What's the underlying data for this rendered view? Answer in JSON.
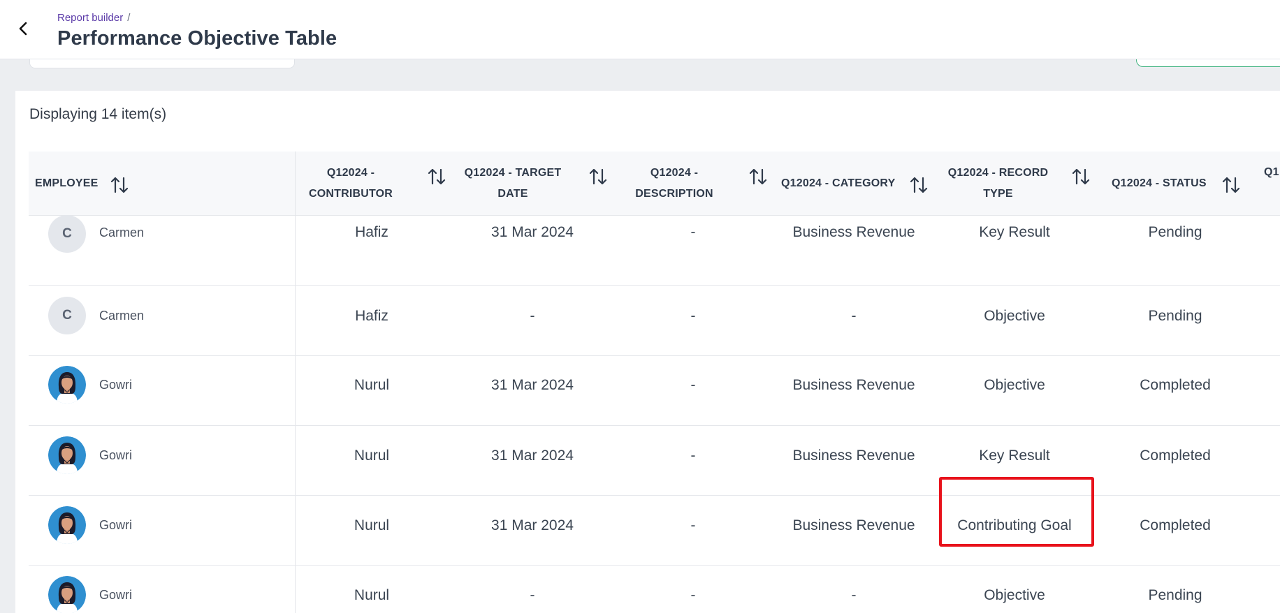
{
  "header": {
    "breadcrumb": "Report builder",
    "breadcrumb_separator": "/",
    "title": "Performance Objective Table"
  },
  "summary": {
    "count_text": "Displaying 14 item(s)"
  },
  "table": {
    "columns": [
      {
        "label": "EMPLOYEE"
      },
      {
        "label": "Q12024 - CONTRIBUTOR"
      },
      {
        "label": "Q12024 - TARGET DATE"
      },
      {
        "label": "Q12024 - DESCRIPTION"
      },
      {
        "label": "Q12024 - CATEGORY"
      },
      {
        "label": "Q12024 - RECORD TYPE"
      },
      {
        "label": "Q12024 - STATUS"
      },
      {
        "label": "Q1"
      }
    ],
    "rows": [
      {
        "employee": "Carmen",
        "initial": "C",
        "avatar": "initial",
        "contributor": "Hafiz",
        "target_date": "31 Mar 2024",
        "description": "-",
        "category": "Business Revenue",
        "record_type": "Key Result",
        "status": "Pending"
      },
      {
        "employee": "Carmen",
        "initial": "C",
        "avatar": "initial",
        "contributor": "Hafiz",
        "target_date": "-",
        "description": "-",
        "category": "-",
        "record_type": "Objective",
        "status": "Pending"
      },
      {
        "employee": "Gowri",
        "initial": "",
        "avatar": "photo",
        "contributor": "Nurul",
        "target_date": "31 Mar 2024",
        "description": "-",
        "category": "Business Revenue",
        "record_type": "Objective",
        "status": "Completed"
      },
      {
        "employee": "Gowri",
        "initial": "",
        "avatar": "photo",
        "contributor": "Nurul",
        "target_date": "31 Mar 2024",
        "description": "-",
        "category": "Business Revenue",
        "record_type": "Key Result",
        "status": "Completed"
      },
      {
        "employee": "Gowri",
        "initial": "",
        "avatar": "photo",
        "contributor": "Nurul",
        "target_date": "31 Mar 2024",
        "description": "-",
        "category": "Business Revenue",
        "record_type": "Contributing Goal",
        "status": "Completed"
      },
      {
        "employee": "Gowri",
        "initial": "",
        "avatar": "photo",
        "contributor": "Nurul",
        "target_date": "-",
        "description": "-",
        "category": "-",
        "record_type": "Objective",
        "status": "Pending"
      }
    ]
  },
  "colors": {
    "accent_breadcrumb": "#5b3aa8",
    "highlight": "#e8121b",
    "action_border": "#3fb27f"
  },
  "icons": {
    "back": "chevron-left-icon",
    "sort": "sort-arrows-icon"
  }
}
